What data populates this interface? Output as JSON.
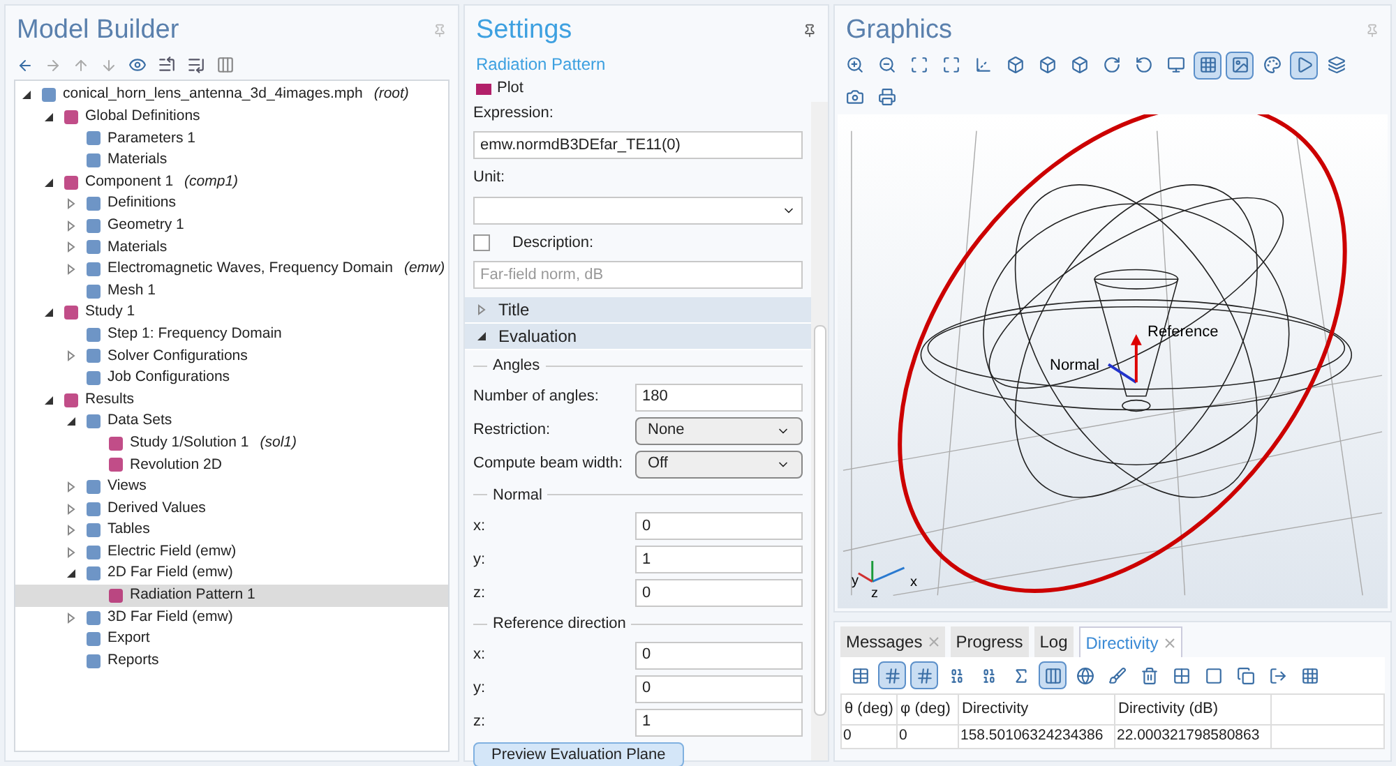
{
  "model_builder": {
    "title": "Model Builder",
    "tree": [
      {
        "label": "conical_horn_lens_antenna_3d_4images.mph",
        "suffix": "(root)",
        "expanded": true,
        "selected": false,
        "children": [
          {
            "label": "Global Definitions",
            "expanded": true,
            "selected": false,
            "children": [
              {
                "label": "Parameters 1",
                "selected": false
              },
              {
                "label": "Materials",
                "selected": false
              }
            ]
          },
          {
            "label": "Component 1",
            "suffix": "(comp1)",
            "expanded": true,
            "selected": false,
            "children": [
              {
                "label": "Definitions",
                "expanded": false,
                "selected": false
              },
              {
                "label": "Geometry 1",
                "expanded": false,
                "selected": false
              },
              {
                "label": "Materials",
                "expanded": false,
                "selected": false
              },
              {
                "label": "Electromagnetic Waves, Frequency Domain",
                "suffix": "(emw)",
                "expanded": false,
                "selected": false
              },
              {
                "label": "Mesh 1",
                "selected": false
              }
            ]
          },
          {
            "label": "Study 1",
            "expanded": true,
            "selected": false,
            "children": [
              {
                "label": "Step 1: Frequency Domain",
                "selected": false
              },
              {
                "label": "Solver Configurations",
                "expanded": false,
                "selected": false
              },
              {
                "label": "Job Configurations",
                "selected": false
              }
            ]
          },
          {
            "label": "Results",
            "expanded": true,
            "selected": false,
            "children": [
              {
                "label": "Data Sets",
                "expanded": true,
                "selected": false,
                "children": [
                  {
                    "label": "Study 1/Solution 1",
                    "suffix": "(sol1)",
                    "selected": false
                  },
                  {
                    "label": "Revolution 2D",
                    "selected": false
                  }
                ]
              },
              {
                "label": "Views",
                "expanded": false,
                "selected": false
              },
              {
                "label": "Derived Values",
                "expanded": false,
                "selected": false
              },
              {
                "label": "Tables",
                "expanded": false,
                "selected": false
              },
              {
                "label": "Electric Field (emw)",
                "expanded": false,
                "selected": false
              },
              {
                "label": "2D Far Field (emw)",
                "expanded": true,
                "selected": false,
                "children": [
                  {
                    "label": "Radiation Pattern 1",
                    "selected": true
                  }
                ]
              },
              {
                "label": "3D Far Field (emw)",
                "expanded": false,
                "selected": false
              },
              {
                "label": "Export",
                "selected": false
              },
              {
                "label": "Reports",
                "selected": false
              }
            ]
          }
        ]
      }
    ]
  },
  "settings": {
    "title": "Settings",
    "subtitle": "Radiation Pattern",
    "plot_label": "Plot",
    "expression": {
      "label": "Expression:",
      "value": "emw.normdB3DEfar_TE11(0)"
    },
    "unit": {
      "label": "Unit:"
    },
    "description": {
      "label": "Description:",
      "checked": false,
      "value": "Far-field norm, dB",
      "disabled": true
    },
    "sections": [
      {
        "title": "Title",
        "expanded": false
      },
      {
        "title": "Evaluation",
        "expanded": true
      }
    ],
    "groups": [
      {
        "title": "Angles",
        "rows": [
          {
            "label": "Number of angles:",
            "kind": "text",
            "value": "180"
          },
          {
            "label": "Restriction:",
            "kind": "select",
            "value": "None"
          },
          {
            "label": "Compute beam width:",
            "kind": "select",
            "value": "Off"
          }
        ]
      },
      {
        "title": "Normal",
        "rows": [
          {
            "label": "x:",
            "kind": "text",
            "value": "0"
          },
          {
            "label": "y:",
            "kind": "text",
            "value": "1"
          },
          {
            "label": "z:",
            "kind": "text",
            "value": "0"
          }
        ]
      },
      {
        "title": "Reference direction",
        "rows": [
          {
            "label": "x:",
            "kind": "text",
            "value": "0"
          },
          {
            "label": "y:",
            "kind": "text",
            "value": "0"
          },
          {
            "label": "z:",
            "kind": "text",
            "value": "1"
          }
        ]
      }
    ],
    "button": "Preview Evaluation Plane"
  },
  "graphics": {
    "title": "Graphics",
    "toolbar": [
      {
        "on": false
      },
      {
        "on": false
      },
      {
        "on": false
      },
      {
        "on": false
      },
      {
        "on": false
      },
      {
        "on": false
      },
      {
        "on": false
      },
      {
        "on": false
      },
      {
        "on": false
      },
      {
        "on": false
      },
      {
        "on": false
      },
      {
        "on": true
      },
      {
        "on": true
      },
      {
        "on": false
      },
      {
        "on": true
      },
      {
        "on": false
      },
      {
        "on": false
      },
      {
        "on": false
      }
    ],
    "labels": [
      "Reference",
      "Normal"
    ],
    "axes": [
      "y",
      "z",
      "x"
    ]
  },
  "results": {
    "tabs": [
      {
        "label": "Messages",
        "selected": false,
        "closable": true
      },
      {
        "label": "Progress",
        "selected": false,
        "closable": false
      },
      {
        "label": "Log",
        "selected": false,
        "closable": false
      },
      {
        "label": "Directivity",
        "selected": true,
        "closable": true
      }
    ],
    "toolbar": [
      {
        "on": false
      },
      {
        "on": true
      },
      {
        "on": true
      },
      {
        "on": false
      },
      {
        "on": false
      },
      {
        "on": false
      },
      {
        "on": true
      },
      {
        "on": false
      },
      {
        "on": false
      },
      {
        "on": false
      },
      {
        "on": false
      },
      {
        "on": false
      },
      {
        "on": false
      },
      {
        "on": false
      },
      {
        "on": false
      }
    ],
    "table": {
      "columns": [
        "θ (deg)",
        "φ (deg)",
        "Directivity",
        "Directivity (dB)"
      ],
      "rows": [
        [
          "0",
          "0",
          "158.50106324234386",
          "22.000321798580863"
        ]
      ]
    }
  }
}
